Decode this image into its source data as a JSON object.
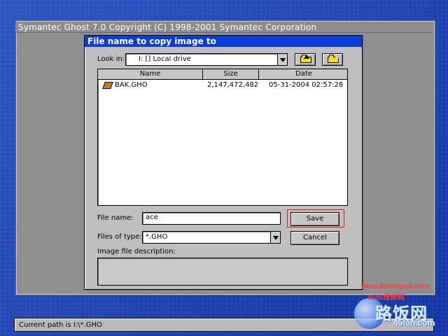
{
  "app": {
    "title": "Symantec Ghost 7.0   Copyright (C) 1998-2001 Symantec Corporation"
  },
  "dialog": {
    "title": "File name to copy image to",
    "look_in_label": "Look in:",
    "look_in_value": "I: [] Local drive",
    "buttons": {
      "save": "Save",
      "cancel": "Cancel"
    },
    "list": {
      "headers": [
        "Name",
        "Size",
        "Date"
      ],
      "rows": [
        {
          "name": "BAK.GHO",
          "size": "2,147,472,482",
          "date": "05-31-2004 02:57:28"
        }
      ]
    },
    "file_name_label": "File name:",
    "file_name_value": "ace",
    "files_of_type_label": "Files of type:",
    "files_of_type_value": "*.GHO",
    "description_label": "Image file description:"
  },
  "statusbar": {
    "label": "Current path is",
    "value": "I:\\*.GHO"
  },
  "watermark": {
    "url": "www.biosrepair.com",
    "cn_small": "Bios维修网",
    "big": "路饭网",
    "small": "45fan.com"
  },
  "colors": {
    "accent": "#0a3ed6",
    "selection": "#d51d24"
  }
}
